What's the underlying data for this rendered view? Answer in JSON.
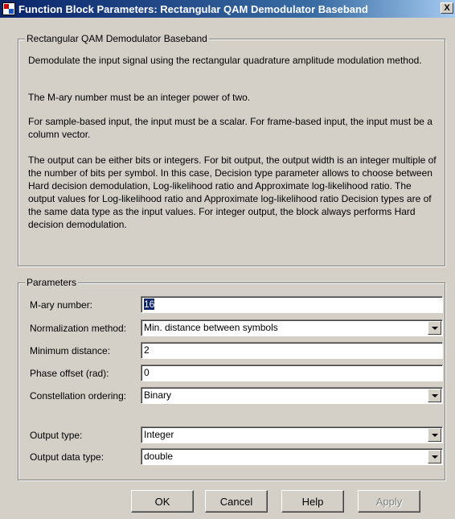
{
  "window": {
    "title": "Function Block Parameters: Rectangular QAM Demodulator Baseband",
    "close_glyph": "X"
  },
  "description": {
    "legend": "Rectangular QAM Demodulator Baseband",
    "paragraphs": [
      "Demodulate the input signal using the rectangular quadrature amplitude modulation method.",
      "The M-ary number must be an integer power of two.",
      "For sample-based input, the input must be a scalar. For frame-based input, the input must be a column vector.",
      "The output can be either bits or integers. For bit output, the output width is an integer multiple of the number of bits per symbol. In this case, Decision type parameter allows to choose between Hard decision demodulation, Log-likelihood ratio and Approximate log-likelihood ratio. The output values for Log-likelihood ratio and Approximate log-likelihood ratio Decision types are of the same data type as the input values. For integer output, the block always performs Hard decision demodulation."
    ]
  },
  "parameters": {
    "legend": "Parameters",
    "mary": {
      "label": "M-ary number:",
      "value": "16"
    },
    "normalization": {
      "label": "Normalization method:",
      "value": "Min. distance between symbols"
    },
    "min_distance": {
      "label": "Minimum distance:",
      "value": "2"
    },
    "phase_offset": {
      "label": "Phase offset (rad):",
      "value": "0"
    },
    "constellation": {
      "label": "Constellation ordering:",
      "value": "Binary"
    },
    "output_type": {
      "label": "Output type:",
      "value": "Integer"
    },
    "output_data_type": {
      "label": "Output data type:",
      "value": "double"
    }
  },
  "buttons": {
    "ok": "OK",
    "cancel": "Cancel",
    "help": "Help",
    "apply": "Apply"
  }
}
